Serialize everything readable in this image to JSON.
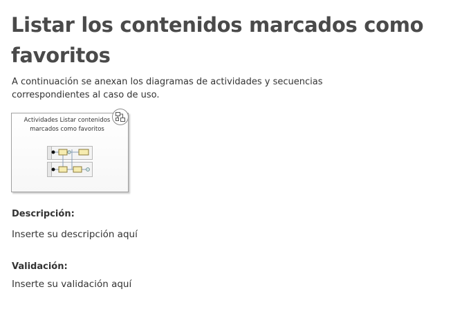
{
  "page": {
    "title": "Listar los contenidos marcados como favoritos",
    "intro": "A continuación se anexan los diagramas de actividades y secuencias correspondientes al caso de uso."
  },
  "diagram": {
    "title": "Actividades Listar contenidos marcados como favoritos",
    "icon": "diagram-link-icon"
  },
  "description": {
    "label": "Descripción:",
    "text": "Inserte su descripción aquí"
  },
  "validation": {
    "label": "Validación:",
    "text": "Inserte su validación aquí"
  }
}
